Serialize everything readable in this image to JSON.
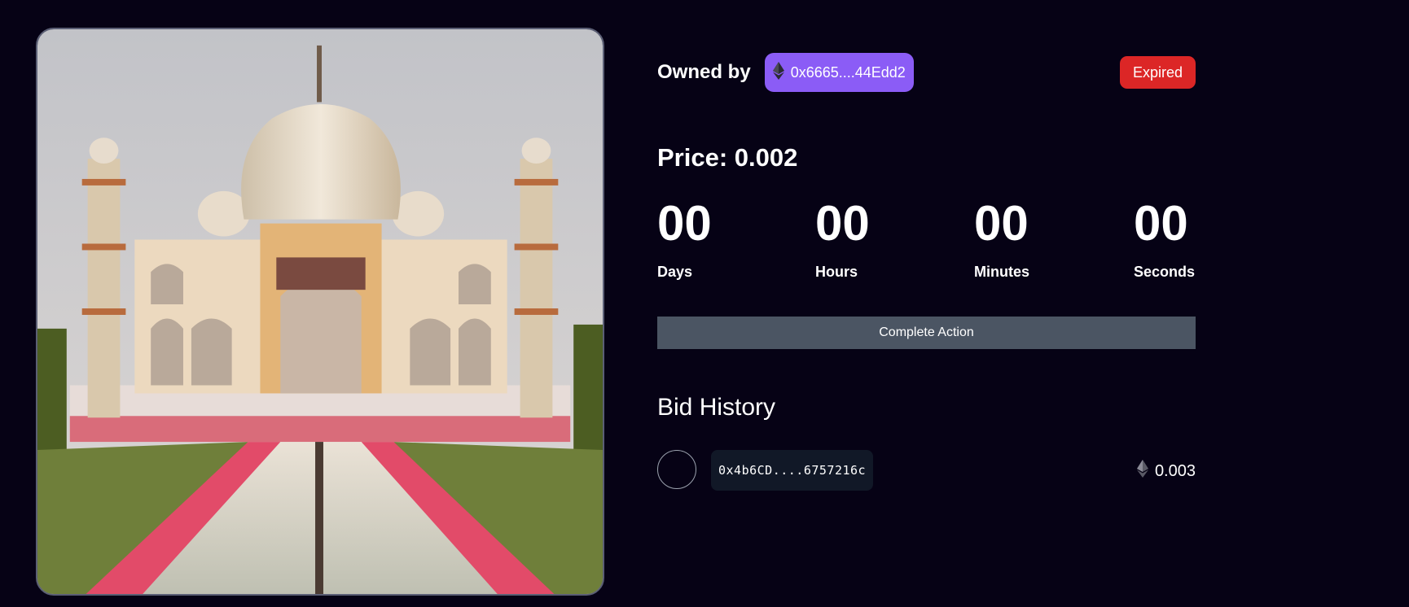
{
  "owner": {
    "label": "Owned by",
    "address": "0x6665....44Edd2"
  },
  "status": {
    "label": "Expired",
    "color": "#dc2626"
  },
  "price": {
    "label": "Price:",
    "value": "0.002"
  },
  "countdown": [
    {
      "value": "00",
      "label": "Days"
    },
    {
      "value": "00",
      "label": "Hours"
    },
    {
      "value": "00",
      "label": "Minutes"
    },
    {
      "value": "00",
      "label": "Seconds"
    }
  ],
  "action": {
    "label": "Complete Action"
  },
  "bid_history": {
    "title": "Bid History",
    "bids": [
      {
        "address": "0x4b6CD....6757216c",
        "amount": "0.003"
      }
    ]
  },
  "colors": {
    "background": "#060215",
    "accent": "#8b5cf6",
    "button": "#4b5563",
    "address_bg": "#111827"
  },
  "icons": {
    "currency": "ethereum-icon"
  }
}
